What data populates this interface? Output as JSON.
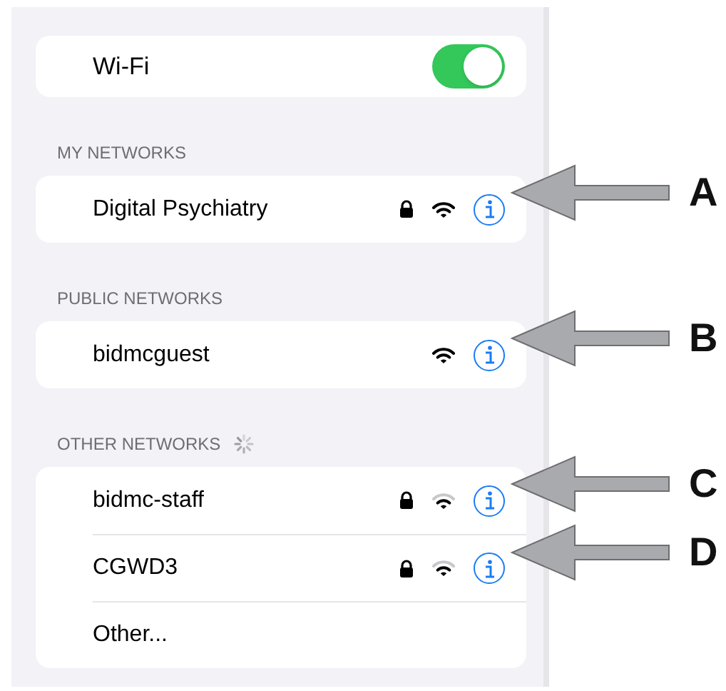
{
  "wifi": {
    "label": "Wi-Fi",
    "on": true
  },
  "sections": [
    {
      "title": "MY NETWORKS",
      "loading": false,
      "rows": [
        {
          "kind": "network",
          "name": "Digital Psychiatry",
          "locked": true,
          "weak_signal": false,
          "callout": "A"
        }
      ]
    },
    {
      "title": "PUBLIC NETWORKS",
      "loading": false,
      "rows": [
        {
          "kind": "network",
          "name": "bidmcguest",
          "locked": false,
          "weak_signal": false,
          "callout": "B"
        }
      ]
    },
    {
      "title": "OTHER NETWORKS",
      "loading": true,
      "rows": [
        {
          "kind": "network",
          "name": "bidmc-staff",
          "locked": true,
          "weak_signal": true,
          "callout": "C"
        },
        {
          "kind": "network",
          "name": "CGWD3",
          "locked": true,
          "weak_signal": true,
          "callout": "D"
        },
        {
          "kind": "other",
          "name": "Other..."
        }
      ]
    }
  ]
}
